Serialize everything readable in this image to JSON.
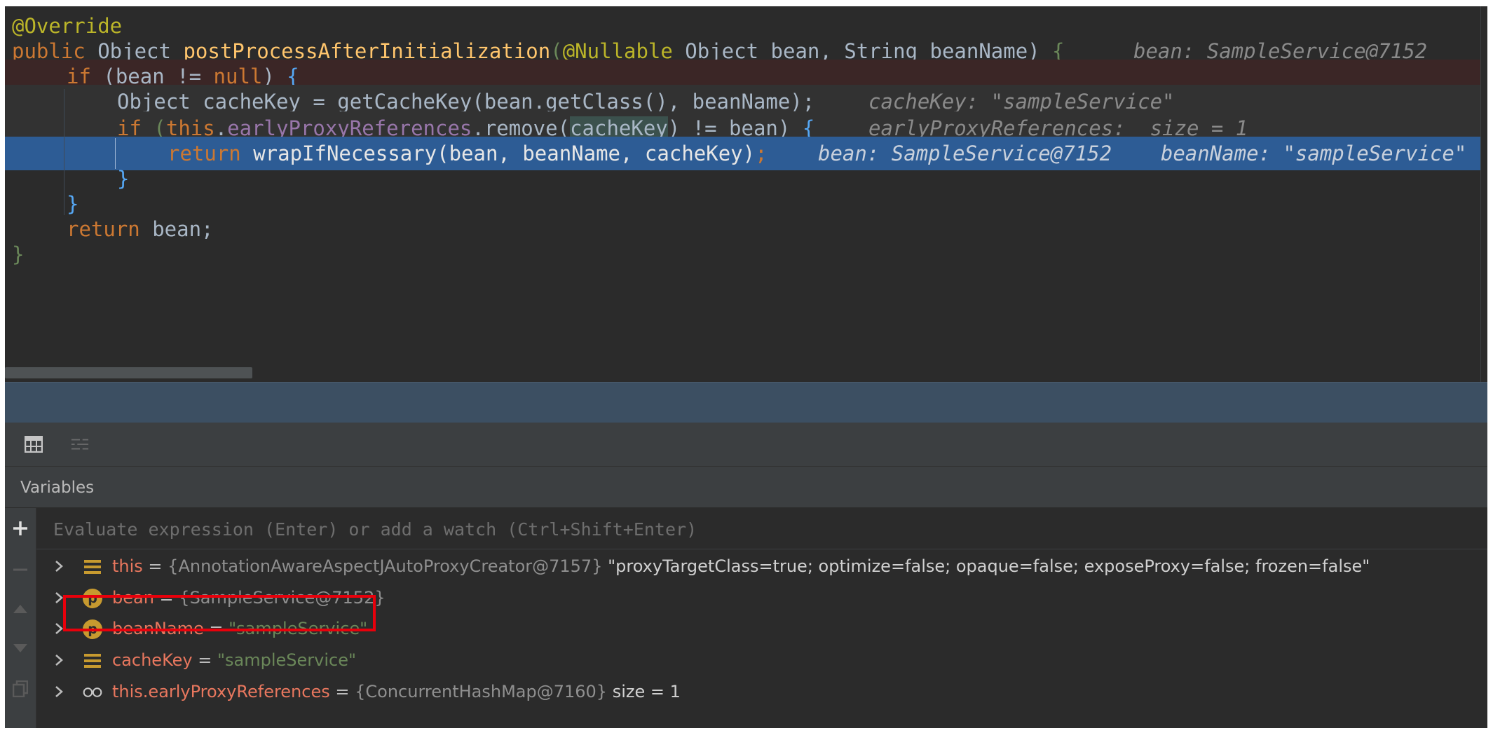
{
  "editor": {
    "lines": {
      "override": "@Override",
      "sig_public": "public ",
      "sig_object": "Object ",
      "sig_method": "postProcessAfterInitialization",
      "sig_paren": "(",
      "sig_nullable": "@Nullable",
      "sig_params": " Object bean, String beanName) ",
      "sig_brace": "{",
      "sig_hint": "bean: SampleService@7152",
      "if1_kw": "if ",
      "if1_body": "(bean != ",
      "if1_null": "null",
      "if1_end": ") ",
      "if1_brace": "{",
      "ck_type": "Object ",
      "ck_var": "cacheKey",
      "ck_rest": " = getCacheKey(bean.getClass(), beanName);",
      "ck_hint": "cacheKey: \"sampleService\"",
      "if2_kw": "if ",
      "if2_open": "(",
      "if2_this": "this",
      "if2_dot": ".",
      "if2_field": "earlyProxyReferences",
      "if2_remove": ".remove(",
      "if2_var": "cacheKey",
      "if2_rest": ") != bean) ",
      "if2_brace": "{",
      "if2_hint": "earlyProxyReferences:  size = 1",
      "ret1_kw": "return ",
      "ret1_call": "wrapIfNecessary",
      "ret1_args": "(bean, beanName, cacheKey)",
      "ret1_semi": ";",
      "ret1_hint": "bean: SampleService@7152    beanName: \"sampleService\"",
      "close_inner": "}",
      "close_if": "}",
      "ret2_kw": "return ",
      "ret2_rest": "bean;",
      "close_method": "}"
    }
  },
  "debugger": {
    "toolbar": {
      "icons": [
        "table-view-icon",
        "layout-settings-icon"
      ]
    },
    "panel_title": "Variables",
    "evaluate": {
      "placeholder": "Evaluate expression (Enter) or add a watch (Ctrl+Shift+Enter)"
    },
    "variables": [
      {
        "icon": "field-icon",
        "name": "this",
        "eq": " = ",
        "type": "{AnnotationAwareAspectJAutoProxyCreator@7157}",
        "value": " \"proxyTargetClass=true; optimize=false; opaque=false; exposeProxy=false; frozen=false\""
      },
      {
        "icon": "parameter-icon",
        "name": "bean",
        "eq": " = ",
        "type": "{SampleService@7152}",
        "value": ""
      },
      {
        "icon": "parameter-icon",
        "name": "beanName",
        "eq": " = ",
        "type": "",
        "value": "\"sampleService\""
      },
      {
        "icon": "field-icon",
        "name": "cacheKey",
        "eq": " = ",
        "type": "",
        "value": "\"sampleService\""
      },
      {
        "icon": "watch-icon",
        "name": "this.earlyProxyReferences",
        "eq": " = ",
        "type": "{ConcurrentHashMap@7160}",
        "value": "  size = 1"
      }
    ],
    "parameter_badge": "p"
  },
  "colors": {
    "editor_bg": "#2b2b2b",
    "execution_line": "#2d5c95",
    "breakpoint_line": "#3b2626",
    "keyword": "#cc7832",
    "annotation": "#bbb529",
    "method": "#ffc66d",
    "field": "#9876aa",
    "variable_name": "#e8775e",
    "string": "#6a8759",
    "highlight_box": "#e8000b"
  }
}
